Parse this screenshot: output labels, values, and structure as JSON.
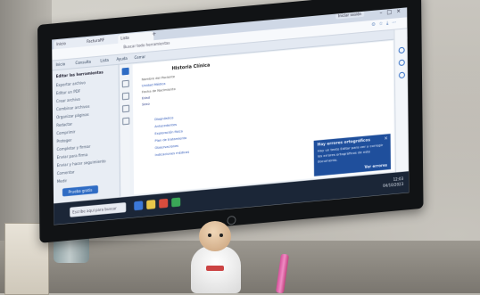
{
  "browser": {
    "tabs": [
      "Inicio",
      "FacturaRF",
      "Lista"
    ],
    "address": "Buscar todo herramientas",
    "login_label": "Iniciar sesión"
  },
  "app_menu": [
    "Inicio",
    "Consulta",
    "Lista",
    "Ayuda",
    "Cerrar"
  ],
  "sidebar": {
    "items": [
      "Editar las herramientas",
      "Exportar archivo",
      "Editar un PDF",
      "Crear archivo",
      "Combinar archivos",
      "Organizar páginas",
      "Redactar",
      "Comprimir",
      "Proteger",
      "Completar y firmar",
      "Enviar para firma",
      "Enviar y hacer seguimiento",
      "Comentar",
      "Medir"
    ],
    "button": "Prueba gratis"
  },
  "document": {
    "title": "Historia Clínica",
    "lines": [
      "Nombre del Paciente",
      "Unidad Médica",
      "Fecha de Nacimiento",
      "Edad",
      "Sexo",
      "Diagnóstico",
      "Antecedentes",
      "Exploración física",
      "Plan de tratamiento",
      "Observaciones",
      "Indicaciones médicas"
    ]
  },
  "toast": {
    "title": "Hay errores ortográficos",
    "lines": [
      "Hay un texto Editar para ver y corregir",
      "los errores ortográficos de este",
      "documento."
    ],
    "action": "Ver errores",
    "close": "×"
  },
  "taskbar": {
    "search_placeholder": "Escribe aquí para buscar",
    "time": "12:03",
    "date": "04/10/2023"
  }
}
